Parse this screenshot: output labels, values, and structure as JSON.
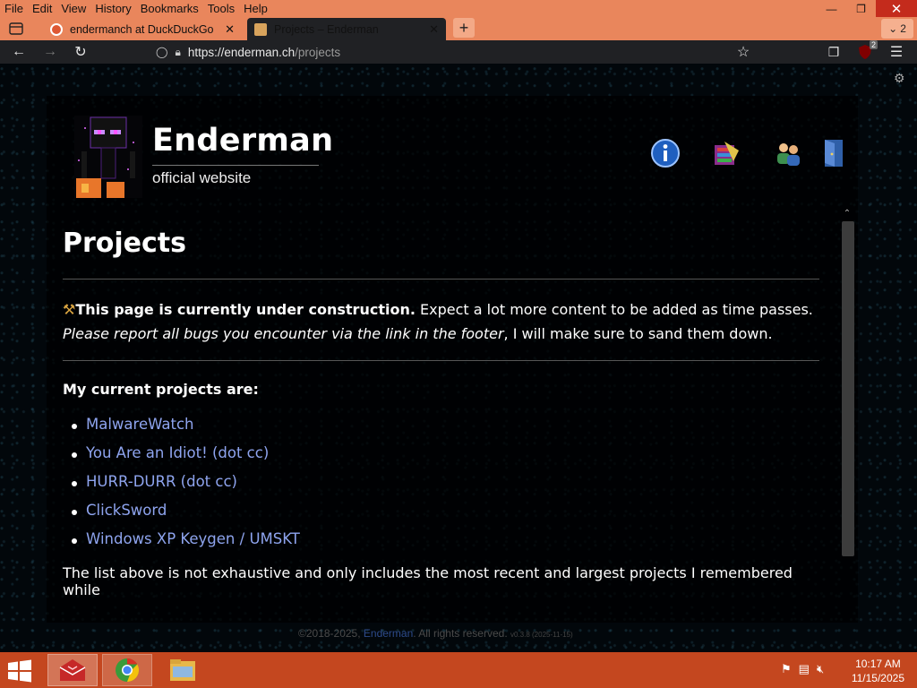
{
  "browser": {
    "menu": [
      "File",
      "Edit",
      "View",
      "History",
      "Bookmarks",
      "Tools",
      "Help"
    ],
    "tabs": [
      {
        "title": "endermanch at DuckDuckGo",
        "active": false
      },
      {
        "title": "Projects – Enderman",
        "active": true
      }
    ],
    "new_tab_label": "+",
    "tab_count": "2",
    "url_host": "https://enderman.ch",
    "url_path": "/projects",
    "extension_badge": "2",
    "accent_color": "#e9865c"
  },
  "site": {
    "title": "Enderman",
    "subtitle": "official website",
    "header_icons": [
      "info-icon",
      "winrar-icon",
      "users-icon",
      "door-exit-icon"
    ]
  },
  "main": {
    "heading": "Projects",
    "notice_bold": "This page is currently under construction.",
    "notice_text": " Expect a lot more content to be added as time passes. ",
    "notice_italic": "Please report all bugs you encounter via the link in the footer",
    "notice_tail": ", I will make sure to sand them down.",
    "projects_heading": "My current projects are:",
    "projects": [
      "MalwareWatch",
      "You Are an Idiot! (dot cc)",
      "HURR-DURR (dot cc)",
      "ClickSword",
      "Windows XP Keygen / UMSKT"
    ],
    "closing": "The list above is not exhaustive and only includes the most recent and largest projects I remembered while"
  },
  "footer": {
    "copyright": "©2018-2025, ",
    "link": "Enderman",
    "rights": ". All rights reserved. ",
    "version": "v0.3.8 (2025-11-15)"
  },
  "taskbar": {
    "time": "10:17 AM",
    "date": "11/15/2025",
    "color": "#c4471f"
  }
}
